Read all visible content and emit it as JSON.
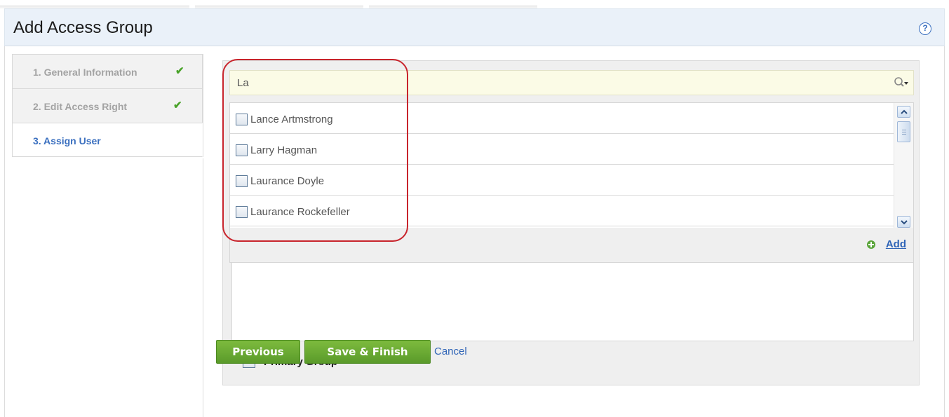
{
  "header": {
    "title": "Add Access Group",
    "help_icon": "question-circle-icon"
  },
  "steps": [
    {
      "label": "1. General Information",
      "completed": true,
      "active": false
    },
    {
      "label": "2. Edit Access Right",
      "completed": true,
      "active": false
    },
    {
      "label": "3. Assign User",
      "completed": false,
      "active": true
    }
  ],
  "search": {
    "value": "La",
    "icon": "search-dropdown-icon"
  },
  "results": [
    {
      "name": "Lance Artmstrong",
      "checked": false
    },
    {
      "name": "Larry Hagman",
      "checked": false
    },
    {
      "name": "Laurance Doyle",
      "checked": false
    },
    {
      "name": "Laurance Rockefeller",
      "checked": false
    }
  ],
  "list_actions": {
    "add_label": "Add",
    "add_icon": "plus-circle-icon"
  },
  "primary_group": {
    "label": "Primary Group",
    "checked": false
  },
  "buttons": {
    "previous": "Previous",
    "save_finish": "Save & Finish",
    "cancel": "Cancel"
  },
  "colors": {
    "accent": "#3a6fbf",
    "button_green": "#6aab33",
    "check_green": "#4aa32a",
    "highlight_red": "#c8242c",
    "search_bg": "#fbfbe6"
  }
}
